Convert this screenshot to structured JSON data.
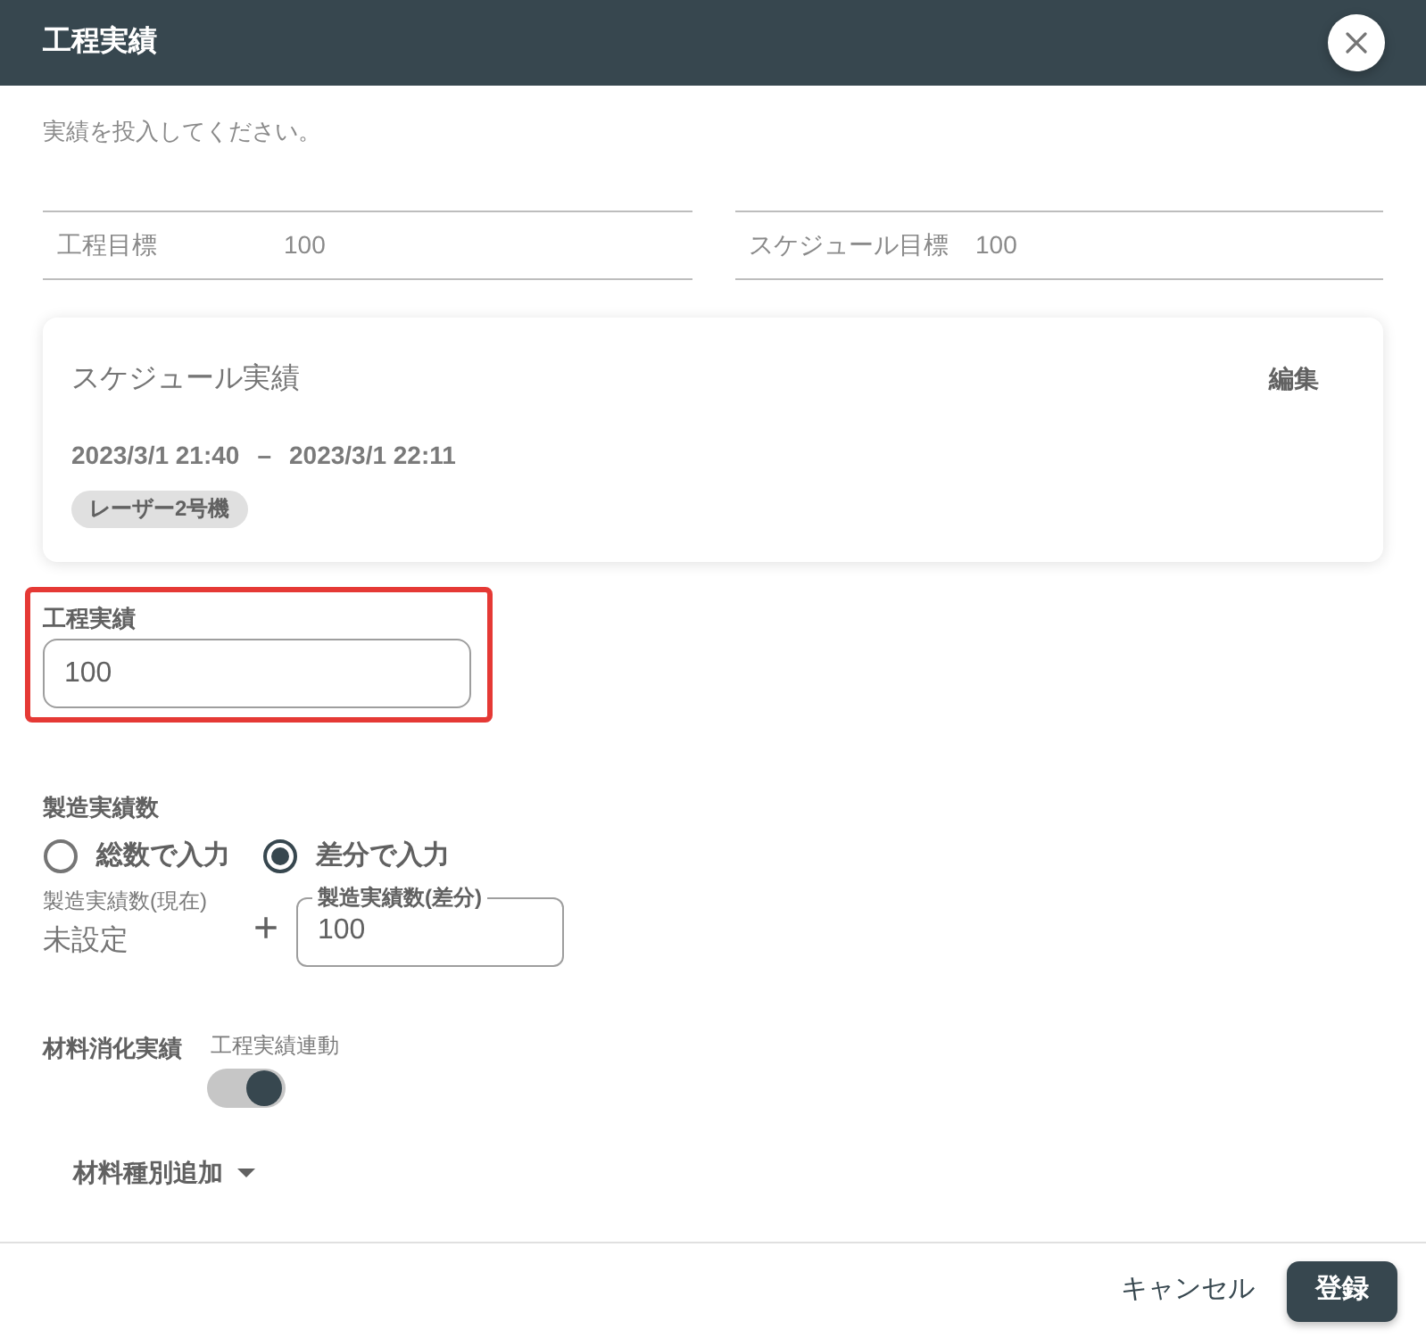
{
  "dialog": {
    "title": "工程実績"
  },
  "instruction": "実績を投入してください。",
  "targets": [
    {
      "label": "工程目標",
      "value": "100"
    },
    {
      "label": "スケジュール目標",
      "value": "100"
    }
  ],
  "schedule_card": {
    "title": "スケジュール実績",
    "edit_action": "編集",
    "start": "2023/3/1 21:40",
    "separator": "–",
    "end": "2023/3/1 22:11",
    "chips": [
      "レーザー2号機"
    ]
  },
  "process_result": {
    "label": "工程実績",
    "value": "100",
    "highlighted": true
  },
  "production_count": {
    "label": "製造実績数",
    "modes": [
      {
        "label": "総数で入力",
        "selected": false
      },
      {
        "label": "差分で入力",
        "selected": true
      }
    ],
    "current_label": "製造実績数(現在)",
    "current_value": "未設定",
    "operator": "+",
    "diff_field": {
      "label": "製造実績数(差分)",
      "value": "100"
    }
  },
  "material": {
    "label": "材料消化実績",
    "link_label": "工程実績連動",
    "link_on": true,
    "add_menu": "材料種別追加"
  },
  "footer": {
    "buttons": [
      {
        "label": "キャンセル",
        "kind": "text"
      },
      {
        "label": "登録",
        "kind": "primary"
      }
    ]
  }
}
